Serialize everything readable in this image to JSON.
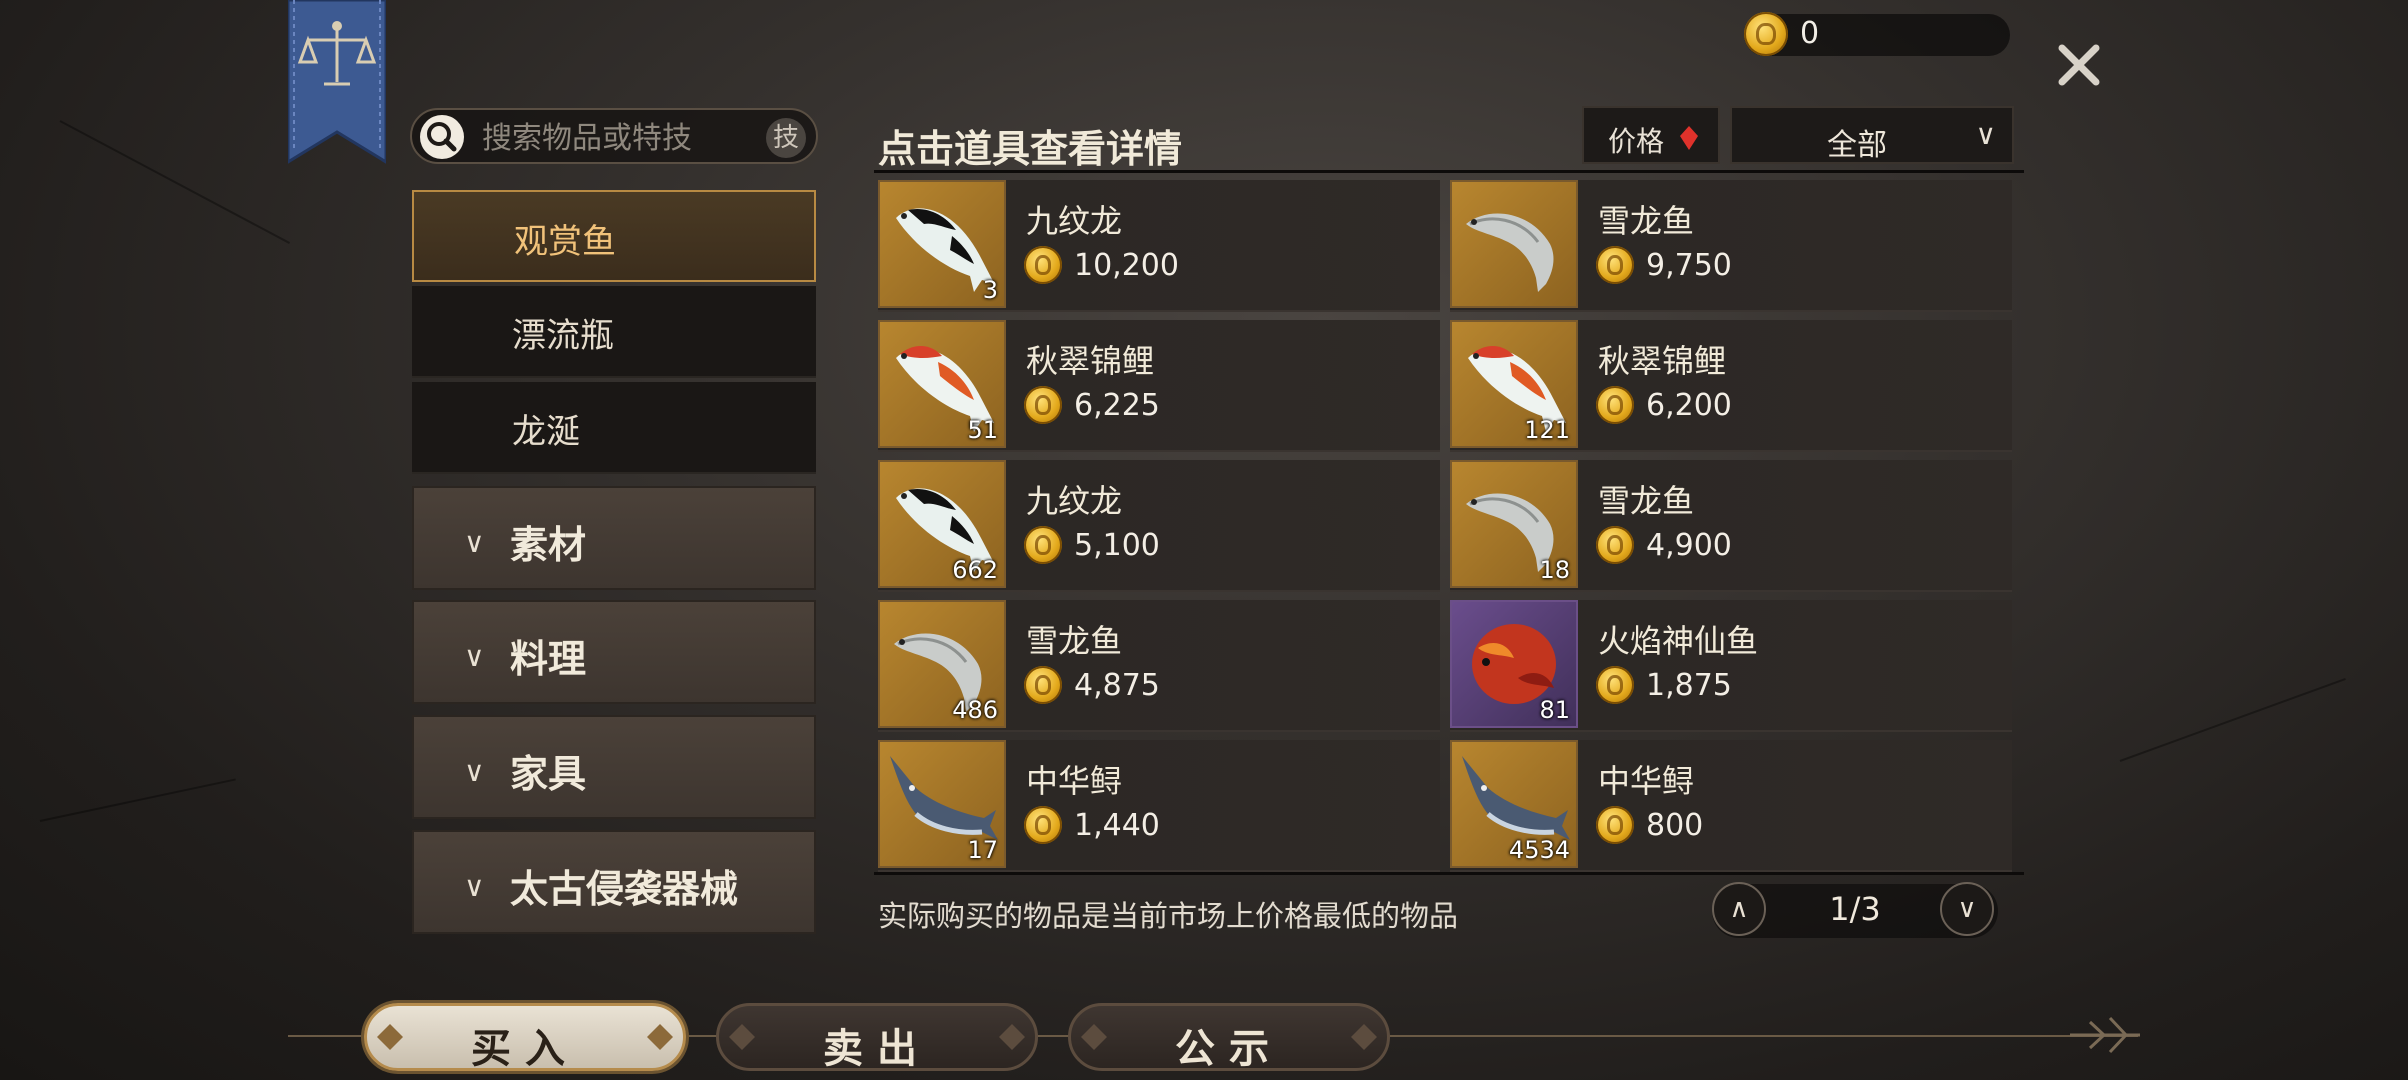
{
  "currency": {
    "amount": "0",
    "icon": "gold-coin-icon"
  },
  "search": {
    "placeholder": "搜索物品或特技",
    "skill_label": "技"
  },
  "sidebar": {
    "subcategories": [
      {
        "label": "观赏鱼",
        "active": true
      },
      {
        "label": "漂流瓶",
        "active": false
      },
      {
        "label": "龙涎",
        "active": false
      }
    ],
    "groups": [
      {
        "label": "素材"
      },
      {
        "label": "料理"
      },
      {
        "label": "家具"
      },
      {
        "label": "太古侵袭器械"
      }
    ]
  },
  "header": {
    "title": "点击道具查看详情",
    "sort_label": "价格",
    "filter_value": "全部"
  },
  "items": [
    {
      "name": "九纹龙",
      "price": "10,200",
      "qty": "3",
      "icon": "black-white-koi-icon"
    },
    {
      "name": "雪龙鱼",
      "price": "9,750",
      "qty": "",
      "icon": "silver-arowana-icon"
    },
    {
      "name": "秋翠锦鲤",
      "price": "6,225",
      "qty": "51",
      "icon": "red-koi-icon"
    },
    {
      "name": "秋翠锦鲤",
      "price": "6,200",
      "qty": "121",
      "icon": "red-koi-icon"
    },
    {
      "name": "九纹龙",
      "price": "5,100",
      "qty": "662",
      "icon": "black-white-koi-icon"
    },
    {
      "name": "雪龙鱼",
      "price": "4,900",
      "qty": "18",
      "icon": "silver-arowana-icon"
    },
    {
      "name": "雪龙鱼",
      "price": "4,875",
      "qty": "486",
      "icon": "silver-arowana-icon"
    },
    {
      "name": "火焰神仙鱼",
      "price": "1,875",
      "qty": "81",
      "icon": "flame-angelfish-icon"
    },
    {
      "name": "中华鲟",
      "price": "1,440",
      "qty": "17",
      "icon": "sturgeon-icon"
    },
    {
      "name": "中华鲟",
      "price": "800",
      "qty": "4534",
      "icon": "sturgeon-icon"
    }
  ],
  "footer": {
    "note": "实际购买的物品是当前市场上价格最低的物品",
    "page": "1/3"
  },
  "tabs": [
    {
      "label": "买入",
      "active": true
    },
    {
      "label": "卖出",
      "active": false
    },
    {
      "label": "公示",
      "active": false
    }
  ],
  "colors": {
    "accent_gold": "#b88a43",
    "sort_arrow": "#e0322b",
    "tile_gold": "#b8862f",
    "tile_purple": "#6a4d8c"
  }
}
